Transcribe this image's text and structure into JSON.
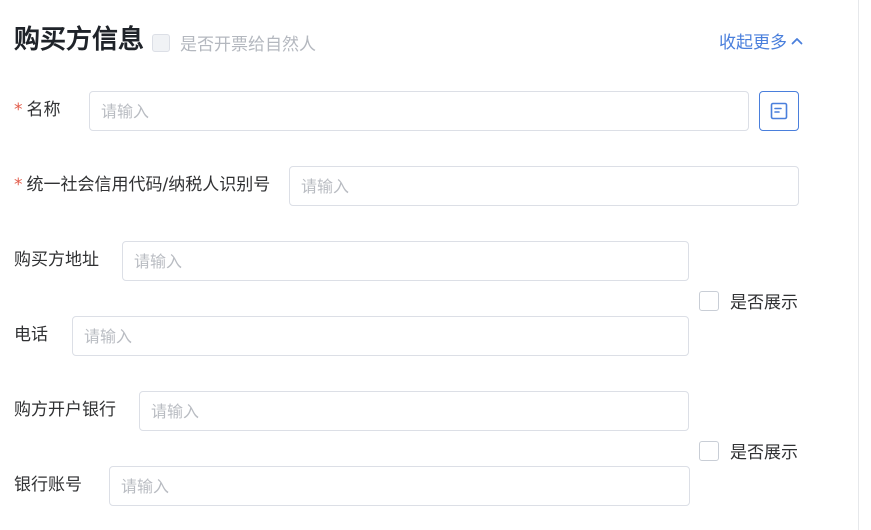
{
  "header": {
    "title": "购买方信息",
    "natural_person_label": "是否开票给自然人",
    "collapse_label": "收起更多"
  },
  "form": {
    "name": {
      "required_mark": "*",
      "label": "名称",
      "placeholder": "请输入"
    },
    "tax_id": {
      "required_mark": "*",
      "label": "统一社会信用代码/纳税人识别号",
      "placeholder": "请输入"
    },
    "address": {
      "label": "购买方地址",
      "placeholder": "请输入"
    },
    "phone": {
      "label": "电话",
      "placeholder": "请输入"
    },
    "bank": {
      "label": "购方开户银行",
      "placeholder": "请输入"
    },
    "account": {
      "label": "银行账号",
      "placeholder": "请输入"
    },
    "show_address_phone": {
      "label": "是否展示",
      "checked": false
    },
    "show_bank_account": {
      "label": "是否展示",
      "checked": false
    }
  },
  "icons": {
    "book": "book-icon",
    "chevron": "chevron-up-icon"
  },
  "colors": {
    "accent": "#4a7fdc",
    "required": "#e25c4a",
    "placeholder": "#b9bcc2"
  }
}
